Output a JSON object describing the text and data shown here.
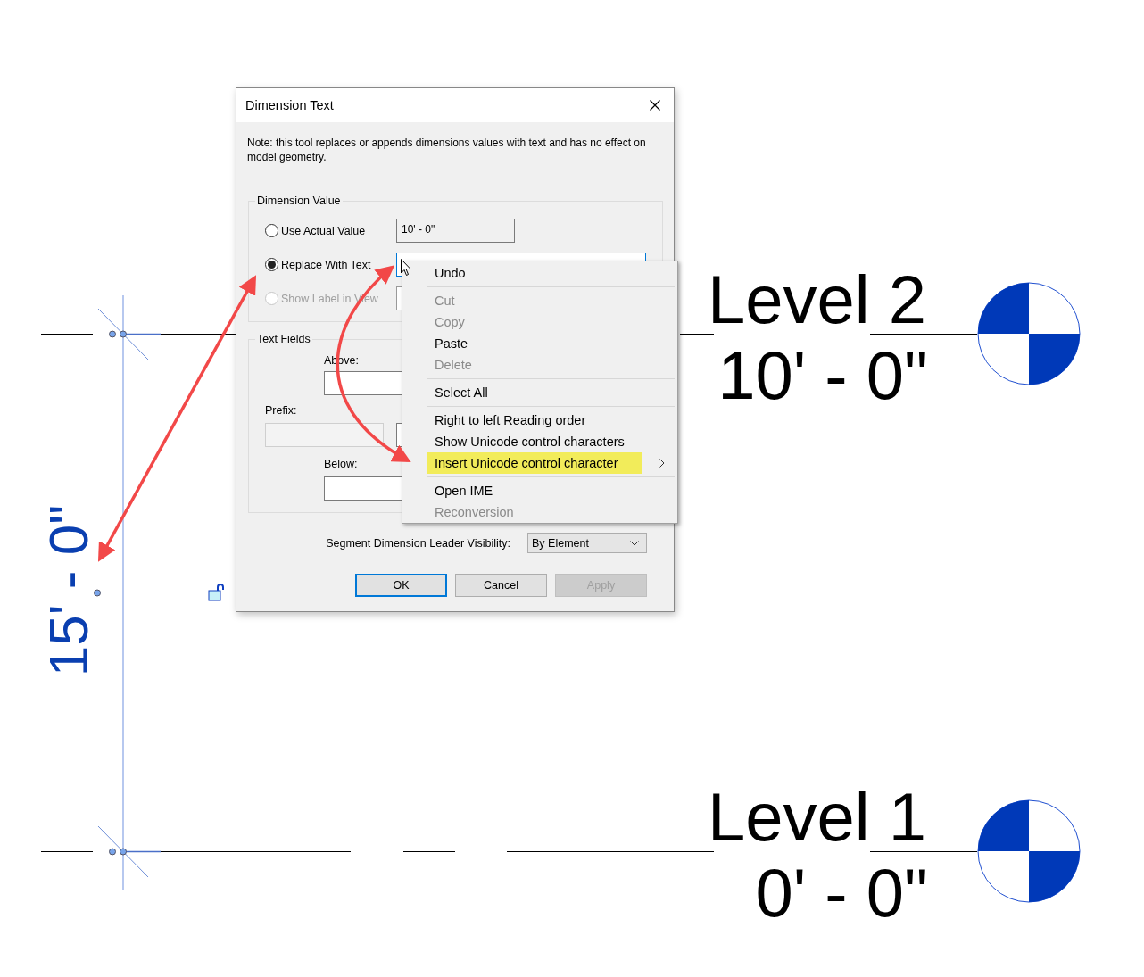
{
  "canvas": {
    "levels": [
      {
        "name": "Level 2",
        "elevation": "10' - 0\""
      },
      {
        "name": "Level 1",
        "elevation": "0' - 0\""
      }
    ],
    "dimension": {
      "value": "15' - 0\""
    }
  },
  "dialog": {
    "title": "Dimension Text",
    "note": "Note: this tool replaces or appends dimensions values with text and has no effect on model geometry.",
    "dimension_value": {
      "legend": "Dimension Value",
      "options": [
        {
          "label": "Use Actual Value",
          "selected": false,
          "disabled": false,
          "field": "10' - 0\""
        },
        {
          "label": "Replace With Text",
          "selected": true,
          "disabled": false
        },
        {
          "label": "Show Label in View",
          "selected": false,
          "disabled": true
        }
      ]
    },
    "text_fields": {
      "legend": "Text Fields",
      "above": "Above:",
      "prefix": "Prefix:",
      "below": "Below:"
    },
    "leader_visibility": {
      "label": "Segment Dimension Leader Visibility:",
      "value": "By Element"
    },
    "buttons": [
      {
        "label": "OK",
        "default": true,
        "disabled": false
      },
      {
        "label": "Cancel",
        "default": false,
        "disabled": false
      },
      {
        "label": "Apply",
        "default": false,
        "disabled": true
      }
    ]
  },
  "context_menu": {
    "groups": [
      [
        {
          "label": "Undo",
          "disabled": false,
          "highlighted": false,
          "submenu": false
        }
      ],
      [
        {
          "label": "Cut",
          "disabled": true,
          "highlighted": false,
          "submenu": false
        },
        {
          "label": "Copy",
          "disabled": true,
          "highlighted": false,
          "submenu": false
        },
        {
          "label": "Paste",
          "disabled": false,
          "highlighted": false,
          "submenu": false
        },
        {
          "label": "Delete",
          "disabled": true,
          "highlighted": false,
          "submenu": false
        }
      ],
      [
        {
          "label": "Select All",
          "disabled": false,
          "highlighted": false,
          "submenu": false
        }
      ],
      [
        {
          "label": "Right to left Reading order",
          "disabled": false,
          "highlighted": false,
          "submenu": false
        },
        {
          "label": "Show Unicode control characters",
          "disabled": false,
          "highlighted": false,
          "submenu": false
        },
        {
          "label": "Insert Unicode control character",
          "disabled": false,
          "highlighted": true,
          "submenu": true
        }
      ],
      [
        {
          "label": "Open IME",
          "disabled": false,
          "highlighted": false,
          "submenu": false
        },
        {
          "label": "Reconversion",
          "disabled": true,
          "highlighted": false,
          "submenu": false
        }
      ]
    ]
  }
}
